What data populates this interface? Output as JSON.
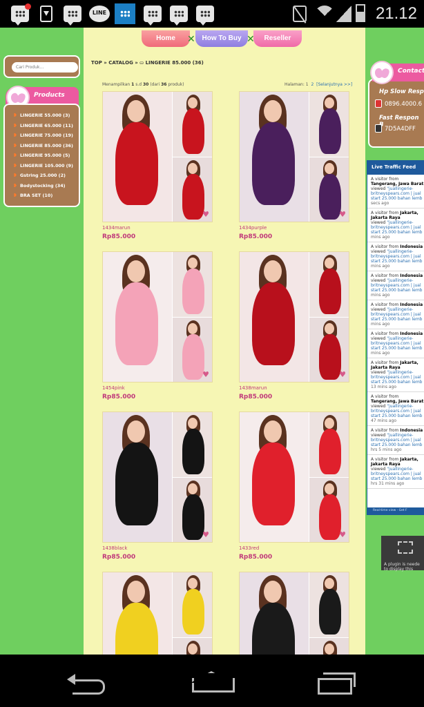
{
  "status_bar": {
    "time": "21.12",
    "notification_icons": [
      "bbm-icon",
      "download-icon",
      "bbm-icon",
      "line-icon",
      "bbm-icon",
      "bbm-icon",
      "bbm-icon",
      "bbm-icon"
    ],
    "line_label": "LINE"
  },
  "nav": {
    "home": "Home",
    "how_to_buy": "How To Buy",
    "reseller": "Reseller"
  },
  "breadcrumb": {
    "top": "TOP",
    "sep1": " » ",
    "catalog": "CATALOG",
    "sep2": " » ",
    "current": "LINGERIE 85.000 (36)"
  },
  "listing": {
    "showing_prefix": "Menampilkan ",
    "from": "1",
    "sd": " s.d ",
    "to": "30",
    "of_prefix": " (dari ",
    "total": "36",
    "of_suffix": " produk)",
    "page_label": "Halaman: ",
    "page1": "1",
    "page2": "2",
    "next": "[Selanjutnya >>]"
  },
  "search": {
    "placeholder": "Cari Produk..."
  },
  "products_widget": {
    "title": "Products",
    "categories": [
      "LINGERIE 55.000 (3)",
      "LINGERIE 65.000 (11)",
      "LINGERIE 75.000 (19)",
      "LINGERIE 85.000 (36)",
      "LINGERIE 95.000 (5)",
      "LINGERIE 105.000 (9)",
      "Gstring 25.000 (2)",
      "Bodystocking (34)",
      "BRA SET (10)"
    ]
  },
  "products": [
    {
      "name": "1434marun",
      "price": "Rp85.000",
      "color": "#c8141e"
    },
    {
      "name": "1434purple",
      "price": "Rp85.000",
      "color": "#4a1f5c"
    },
    {
      "name": "1454pink",
      "price": "Rp85.000",
      "color": "#f4a3b8"
    },
    {
      "name": "1438marun",
      "price": "Rp85.000",
      "color": "#b8101c"
    },
    {
      "name": "1438black",
      "price": "Rp85.000",
      "color": "#141414"
    },
    {
      "name": "1433red",
      "price": "Rp85.000",
      "color": "#e0202c"
    },
    {
      "name": "",
      "price": "",
      "color": "#f0d020"
    },
    {
      "name": "",
      "price": "",
      "color": "#1a1a1a"
    }
  ],
  "contact": {
    "title": "Contact",
    "sms_label": "Hp Slow Resp",
    "sms_number": "0896.4000.6",
    "bb_label": "Fast Respon B",
    "bb_pin": "7D5A4DFF"
  },
  "live_traffic": {
    "title": "Live Traffic Feed",
    "footer": "Real-time view · Get F",
    "visits": [
      {
        "prefix": "A visitor from ",
        "location": "Tangerang, Jawa Barat",
        "viewed": "viewed ",
        "page": "\"juallingerie-britneyspears.com | jual start 25.000 bahan lemb",
        "ago": "secs ago"
      },
      {
        "prefix": "A visitor from ",
        "location": "Jakarta, Jakarta Raya",
        "viewed": "viewed ",
        "page": "\"juallingerie-britneyspears.com | jual start 25.000 bahan lemb",
        "ago": "mins ago"
      },
      {
        "prefix": "A visitor from ",
        "location": "Indonesia",
        "viewed": "viewed ",
        "page": "\"juallingerie-britneyspears.com | jual start 25.000 bahan lemb",
        "ago": "mins ago"
      },
      {
        "prefix": "A visitor from ",
        "location": "Indonesia",
        "viewed": "viewed ",
        "page": "\"juallingerie-britneyspears.com | jual start 25.000 bahan lemb",
        "ago": "mins ago"
      },
      {
        "prefix": "A visitor from ",
        "location": "Indonesia",
        "viewed": "viewed ",
        "page": "\"juallingerie-britneyspears.com | jual start 25.000 bahan lemb",
        "ago": "mins ago"
      },
      {
        "prefix": "A visitor from ",
        "location": "Indonesia",
        "viewed": "viewed ",
        "page": "\"juallingerie-britneyspears.com | jual start 25.000 bahan lemb",
        "ago": "mins ago"
      },
      {
        "prefix": "A visitor from ",
        "location": "Jakarta, Jakarta Raya",
        "viewed": "viewed ",
        "page": "\"juallingerie-britneyspears.com | jual start 25.000 bahan lemb",
        "ago": "13 mins ago"
      },
      {
        "prefix": "A visitor from ",
        "location": "Tangerang, Jawa Barat",
        "viewed": "viewed ",
        "page": "\"juallingerie-britneyspears.com | jual start 25.000 bahan lemb",
        "ago": "47 mins ago"
      },
      {
        "prefix": "A visitor from ",
        "location": "Indonesia",
        "viewed": "viewed ",
        "page": "\"juallingerie-britneyspears.com | jual start 25.000 bahan lemb",
        "ago": "hrs 5 mins ago"
      },
      {
        "prefix": "A visitor from ",
        "location": "Jakarta, Jakarta Raya",
        "viewed": "viewed ",
        "page": "\"juallingerie-britneyspears.com | jual start 25.000 bahan lemb",
        "ago": "hrs 31 mins ago"
      }
    ]
  },
  "plugin": {
    "message": "A plugin is neede to display this"
  }
}
